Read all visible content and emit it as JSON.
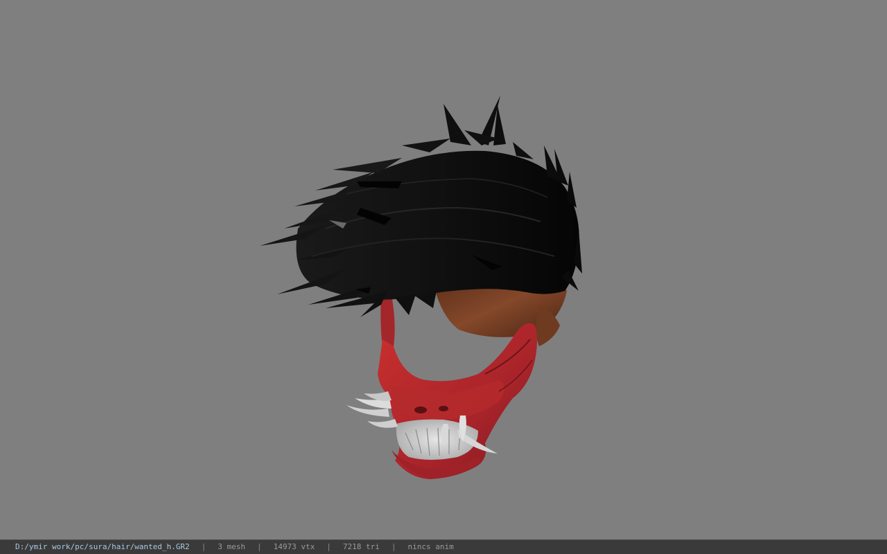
{
  "status_bar": {
    "path": "D:/ymir work/pc/sura/hair/wanted_h.GR2",
    "separator": "|",
    "mesh_count": "3 mesh",
    "vertex_count": "14973 vtx",
    "triangle_count": "7218 tri",
    "anim_status": "nincs anim"
  },
  "colors": {
    "viewport_background": "#7f7f7f",
    "status_background": "#3a3a3a",
    "path_text": "#a8c8e0",
    "hair": "#121212",
    "skin": "#7a4326",
    "mask": "#b3282a",
    "teeth": "#d8d8d8"
  },
  "model": {
    "icon": "3d-model-hair-mask"
  }
}
